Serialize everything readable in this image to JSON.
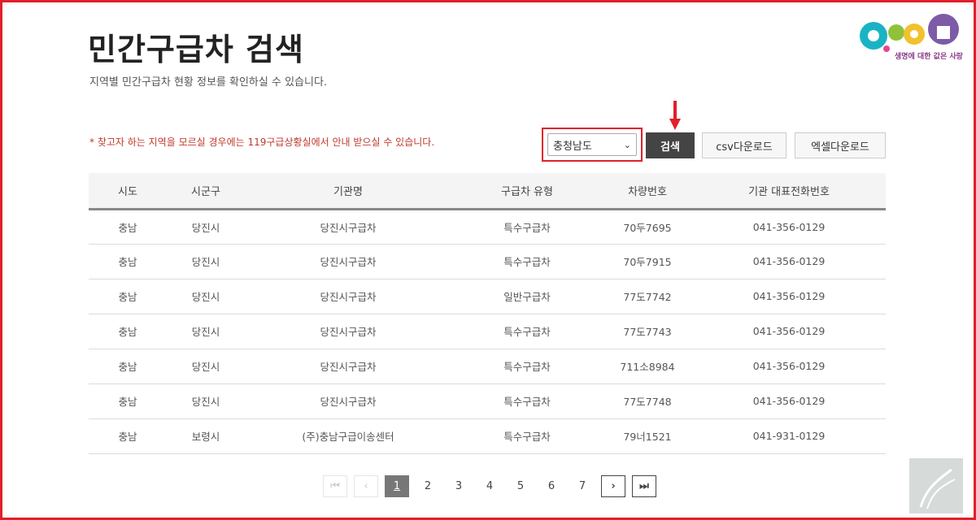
{
  "page": {
    "title": "민간구급차 검색",
    "subtitle": "지역별 민간구급차 현황 정보를 확인하실 수 있습니다.",
    "notice": "* 찾고자 하는 지역을 모르실 경우에는 119구급상황실에서 안내 받으실 수 있습니다."
  },
  "logo": {
    "text": "생명에 대한 값은 사랑"
  },
  "filter": {
    "region_selected": "충청남도",
    "search_label": "검색",
    "csv_label": "csv다운로드",
    "excel_label": "엑셀다운로드"
  },
  "table": {
    "headers": [
      "시도",
      "시군구",
      "기관명",
      "구급차 유형",
      "차량번호",
      "기관 대표전화번호"
    ],
    "rows": [
      [
        "충남",
        "당진시",
        "당진시구급차",
        "특수구급차",
        "70두7695",
        "041-356-0129"
      ],
      [
        "충남",
        "당진시",
        "당진시구급차",
        "특수구급차",
        "70두7915",
        "041-356-0129"
      ],
      [
        "충남",
        "당진시",
        "당진시구급차",
        "일반구급차",
        "77도7742",
        "041-356-0129"
      ],
      [
        "충남",
        "당진시",
        "당진시구급차",
        "특수구급차",
        "77도7743",
        "041-356-0129"
      ],
      [
        "충남",
        "당진시",
        "당진시구급차",
        "특수구급차",
        "711소8984",
        "041-356-0129"
      ],
      [
        "충남",
        "당진시",
        "당진시구급차",
        "특수구급차",
        "77도7748",
        "041-356-0129"
      ],
      [
        "충남",
        "보령시",
        "(주)충남구급이송센터",
        "특수구급차",
        "79너1521",
        "041-931-0129"
      ]
    ]
  },
  "pagination": {
    "pages": [
      "1",
      "2",
      "3",
      "4",
      "5",
      "6",
      "7"
    ],
    "current": "1"
  },
  "colors": {
    "highlight": "#e0202a",
    "notice": "#c0392b",
    "search_button": "#444444"
  }
}
